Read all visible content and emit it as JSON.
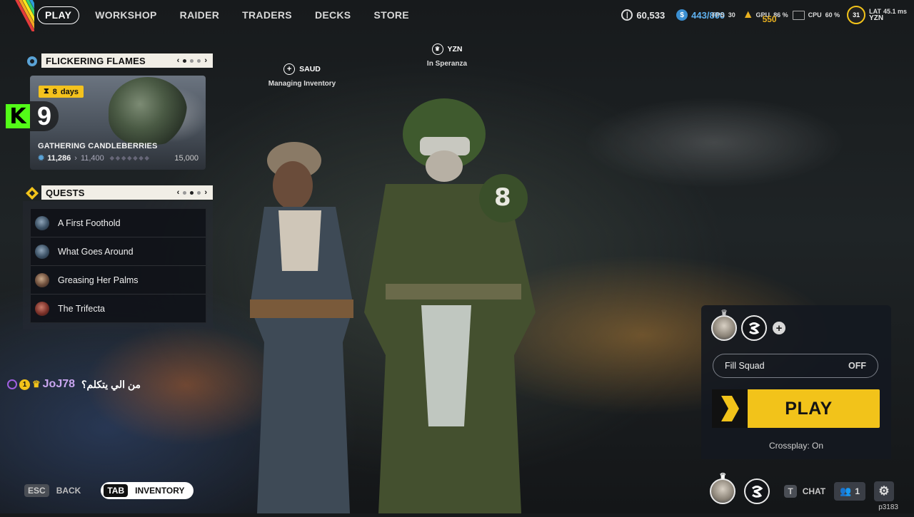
{
  "nav": {
    "items": [
      {
        "label": "PLAY",
        "active": true
      },
      {
        "label": "WORKSHOP",
        "active": false
      },
      {
        "label": "RAIDER",
        "active": false
      },
      {
        "label": "TRADERS",
        "active": false
      },
      {
        "label": "DECKS",
        "active": false
      },
      {
        "label": "STORE",
        "active": false
      }
    ]
  },
  "hud": {
    "coins": "60,533",
    "raider_tokens": "443/800",
    "fps_label": "FPS",
    "fps_value": "30",
    "gpu_label": "GPU",
    "gpu_value": "86 %",
    "cpu_label": "CPU",
    "cpu_value": "60 %",
    "lat_label": "LAT",
    "lat_value": "45.1 ms",
    "gold_value": "550",
    "level": "31",
    "username": "YZN",
    "accent": "#f2c31a"
  },
  "event": {
    "header": "FLICKERING FLAMES",
    "timer_value": "8",
    "timer_unit": "days",
    "title": "GATHERING CANDLEBERRIES",
    "progress_current": "11,286",
    "progress_next": "11,400",
    "progress_max": "15,000"
  },
  "kick": {
    "logo": "K",
    "viewers": "9"
  },
  "quests": {
    "header": "QUESTS",
    "items": [
      {
        "label": "A First Foothold"
      },
      {
        "label": "What Goes Around"
      },
      {
        "label": "Greasing Her Palms"
      },
      {
        "label": "The Trifecta"
      }
    ]
  },
  "players": {
    "left_name": "SAUD",
    "left_status": "Managing Inventory",
    "right_name": "YZN",
    "right_status": "In Speranza"
  },
  "chat": {
    "badge_count": "1",
    "user": "JoJ78",
    "message": "من الي يتكلم؟"
  },
  "squad": {
    "fill_label": "Fill Squad",
    "fill_value": "OFF",
    "play_label": "PLAY",
    "crossplay": "Crossplay: On"
  },
  "bottom": {
    "esc_key": "ESC",
    "back_label": "BACK",
    "tab_key": "TAB",
    "inventory_label": "INVENTORY",
    "chat_key": "T",
    "chat_label": "CHAT",
    "friends_count": "1",
    "build": "p3183"
  }
}
